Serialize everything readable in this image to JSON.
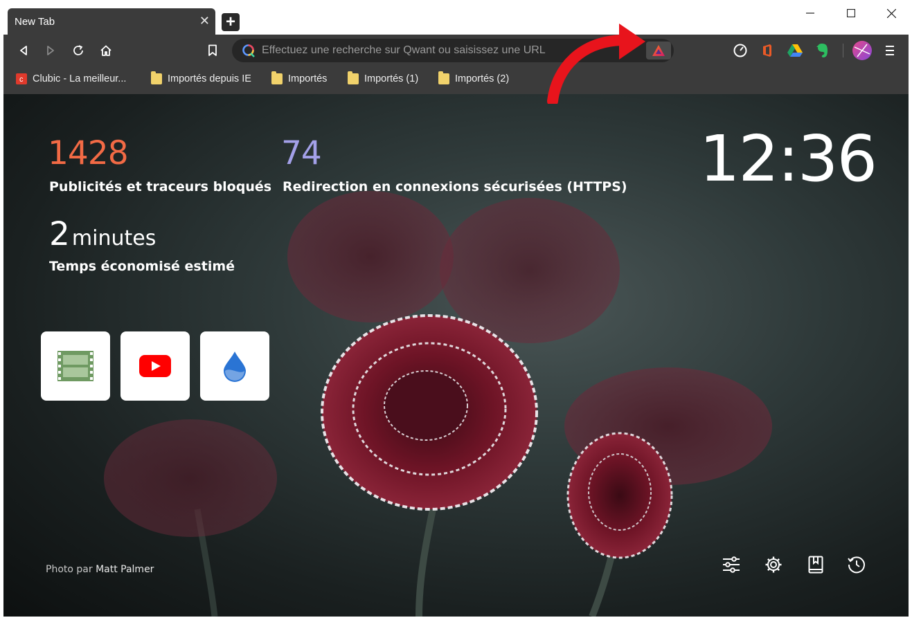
{
  "tab": {
    "title": "New Tab",
    "close": "✕"
  },
  "newtab": {
    "label": "+"
  },
  "window": {
    "minimize": "—",
    "maximize": "☐",
    "close": "✕"
  },
  "urlbar": {
    "placeholder": "Effectuez une recherche sur Qwant ou saisissez une URL"
  },
  "bookmarks": [
    {
      "label": "Clubic - La meilleur...",
      "icon": "clubic-icon"
    },
    {
      "label": "Importés depuis IE",
      "icon": "folder-icon"
    },
    {
      "label": "Importés",
      "icon": "folder-icon"
    },
    {
      "label": "Importés (1)",
      "icon": "folder-icon"
    },
    {
      "label": "Importés (2)",
      "icon": "folder-icon"
    }
  ],
  "stats": {
    "ads_count": "1428",
    "ads_label": "Publicités et traceurs bloqués",
    "https_count": "74",
    "https_label": "Redirection en connexions sécurisées (HTTPS)",
    "time_value": "2",
    "time_unit": "minutes",
    "time_label": "Temps économisé estimé"
  },
  "clock": "12:36",
  "top_sites": [
    {
      "icon": "film-icon"
    },
    {
      "icon": "youtube-icon"
    },
    {
      "icon": "water-drop-icon"
    }
  ],
  "credit": {
    "prefix": "Photo par",
    "author": "Matt Palmer"
  },
  "colors": {
    "ads": "#f26a45",
    "https": "#a3a0e8",
    "chrome": "#3b3b3b",
    "arrow": "#e8141c"
  }
}
